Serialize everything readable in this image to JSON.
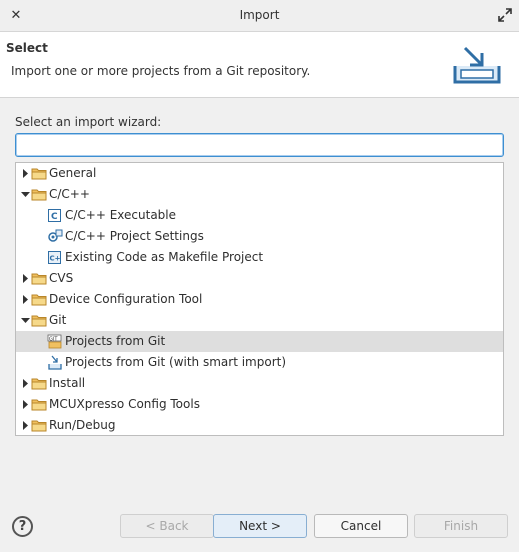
{
  "window": {
    "title": "Import"
  },
  "header": {
    "title": "Select",
    "description": "Import one or more projects from a Git repository."
  },
  "wizard": {
    "label": "Select an import wizard:",
    "filter_value": ""
  },
  "tree": {
    "rows": [
      {
        "label": "General",
        "kind": "folder",
        "state": "collapsed"
      },
      {
        "label": "C/C++",
        "kind": "folder",
        "state": "expanded"
      },
      {
        "label": "C/C++ Executable",
        "kind": "cexe-icon",
        "state": "leaf"
      },
      {
        "label": "C/C++ Project Settings",
        "kind": "settings-icon",
        "state": "leaf"
      },
      {
        "label": "Existing Code as Makefile Project",
        "kind": "makefile-icon",
        "state": "leaf"
      },
      {
        "label": "CVS",
        "kind": "folder",
        "state": "collapsed"
      },
      {
        "label": "Device Configuration Tool",
        "kind": "folder",
        "state": "collapsed"
      },
      {
        "label": "Git",
        "kind": "folder",
        "state": "expanded"
      },
      {
        "label": "Projects from Git",
        "kind": "git-icon",
        "state": "leaf",
        "selected": true
      },
      {
        "label": "Projects from Git (with smart import)",
        "kind": "git-import-icon",
        "state": "leaf"
      },
      {
        "label": "Install",
        "kind": "folder",
        "state": "collapsed"
      },
      {
        "label": "MCUXpresso Config Tools",
        "kind": "folder",
        "state": "collapsed"
      },
      {
        "label": "Run/Debug",
        "kind": "folder",
        "state": "collapsed"
      }
    ]
  },
  "footer": {
    "help": "?",
    "back": "< Back",
    "next": "Next >",
    "cancel": "Cancel",
    "finish": "Finish"
  },
  "colors": {
    "accent": "#3d8fd1",
    "folder": "#f0c060",
    "selection": "#dedede"
  }
}
